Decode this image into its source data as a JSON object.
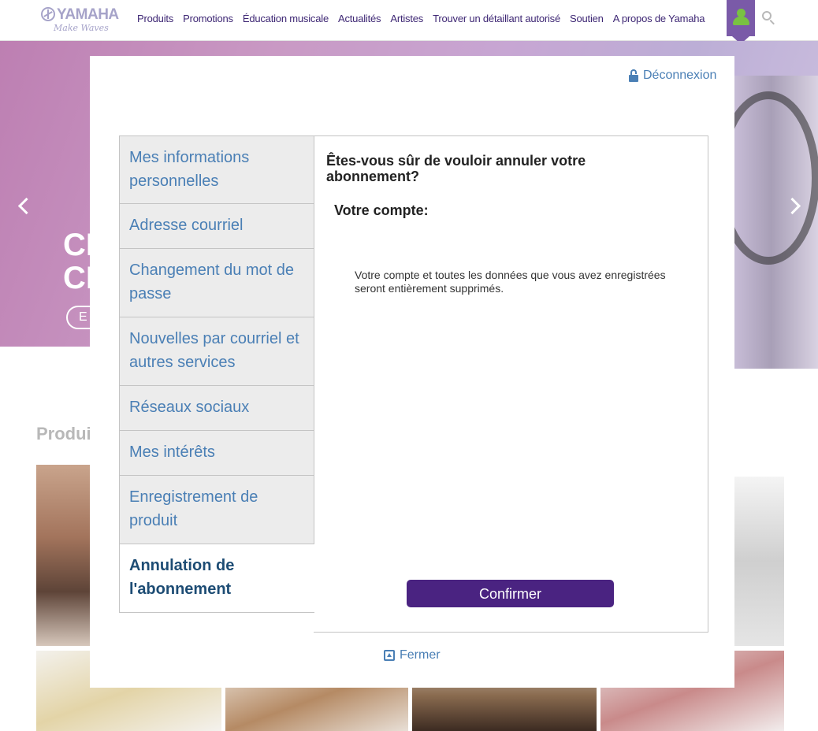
{
  "brand": {
    "name": "YAMAHA",
    "tagline": "Make Waves"
  },
  "nav": {
    "items": [
      {
        "label": "Produits"
      },
      {
        "label": "Promotions"
      },
      {
        "label": "Éducation musicale"
      },
      {
        "label": "Actualités"
      },
      {
        "label": "Artistes"
      },
      {
        "label": "Trouver un détaillant autorisé"
      },
      {
        "label": "Soutien"
      },
      {
        "label": "A propos de Yamaha"
      }
    ]
  },
  "background": {
    "hero_title_line1": "CR",
    "hero_title_line2": "CR",
    "hero_button": "E",
    "section_heading": "Produit"
  },
  "modal": {
    "logout_label": "Déconnexion",
    "menu": [
      {
        "label": "Mes informations personnelles"
      },
      {
        "label": "Adresse courriel"
      },
      {
        "label": "Changement du mot de passe"
      },
      {
        "label": "Nouvelles par courriel et autres services"
      },
      {
        "label": "Réseaux sociaux"
      },
      {
        "label": "Mes intérêts"
      },
      {
        "label": "Enregistrement de produit"
      },
      {
        "label": "Annulation de l'abonnement"
      }
    ],
    "panel": {
      "title": "Êtes-vous sûr de vouloir annuler votre abonnement?",
      "subtitle": "Votre compte:",
      "body": "Votre compte et toutes les données que vous avez enregistrées seront entièrement supprimés.",
      "confirm_label": "Confirmer"
    },
    "close_label": "Fermer"
  },
  "colors": {
    "brand_purple": "#4a2381",
    "link_blue": "#4a7fb5",
    "active_menu_text": "#1d4c74",
    "user_tab": "#7a5aa8",
    "user_icon": "#79c142"
  }
}
